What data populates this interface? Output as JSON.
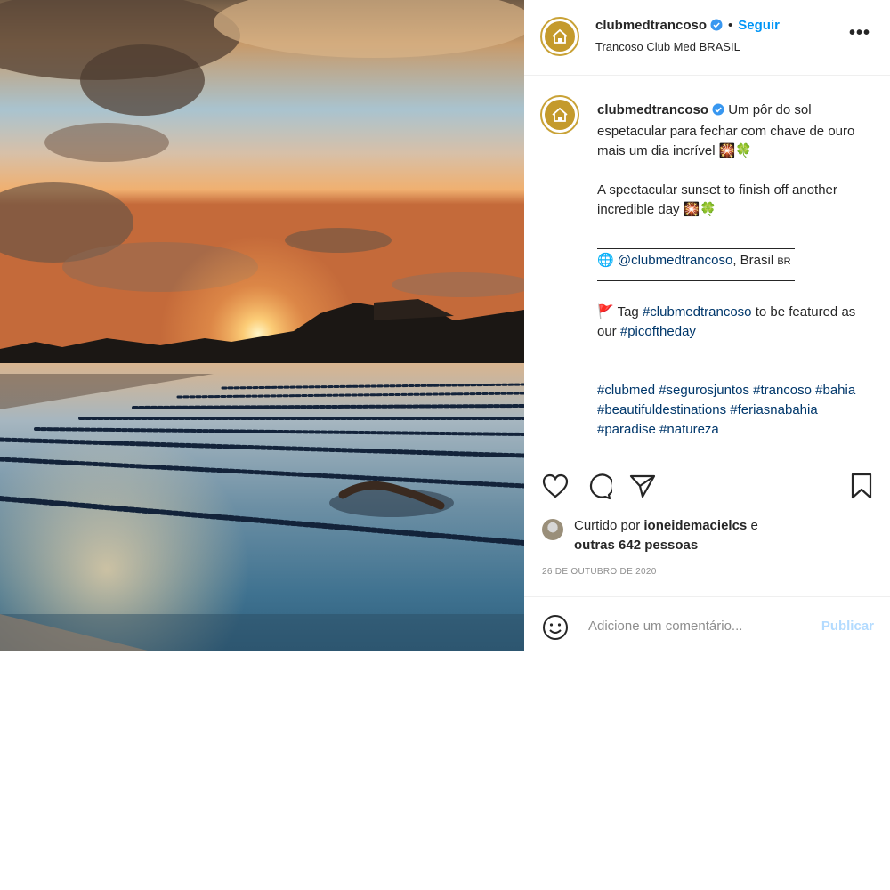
{
  "post": {
    "header": {
      "username": "clubmedtrancoso",
      "separator": "•",
      "follow_label": "Seguir",
      "location": "Trancoso Club Med BRASIL",
      "more_label": "•••"
    },
    "caption": {
      "username": "clubmedtrancoso",
      "text_pt": "Um pôr do sol espetacular para fechar com chave de ouro mais um dia incrível 🎇🍀",
      "text_en": "A spectacular sunset to finish off another incredible day 🎇🍀",
      "mention_prefix": "🌐",
      "mention": "@clubmedtrancoso",
      "mention_suffix": ", Brasil",
      "flag_label": "BR",
      "tag_flag": "🚩",
      "tag_prefix": "Tag",
      "tag_handle": "#clubmedtrancoso",
      "tag_mid": "to be featured as our",
      "tag_hashtag": "#picoftheday",
      "hashtags": "#clubmed #segurosjuntos #trancoso #bahia #beautifuldestinations #feriasnabahia #paradise #natureza"
    },
    "likes": {
      "prefix": "Curtido por",
      "user": "ioneidemacielcs",
      "conj": "e",
      "others": "outras 642 pessoas"
    },
    "date": "26 DE OUTUBRO DE 2020",
    "comment": {
      "placeholder": "Adicione um comentário...",
      "publish_label": "Publicar"
    },
    "icons": {
      "like": "heart-icon",
      "comment": "comment-icon",
      "share": "share-icon",
      "save": "bookmark-icon",
      "emoji": "emoji-icon",
      "verified": "verified-badge-icon"
    },
    "colors": {
      "accent": "#0095f6",
      "hashtag": "#00376b",
      "publish_disabled": "#b3dbff",
      "muted": "#8e8e8e",
      "logo_gold": "#c49a2c"
    }
  }
}
